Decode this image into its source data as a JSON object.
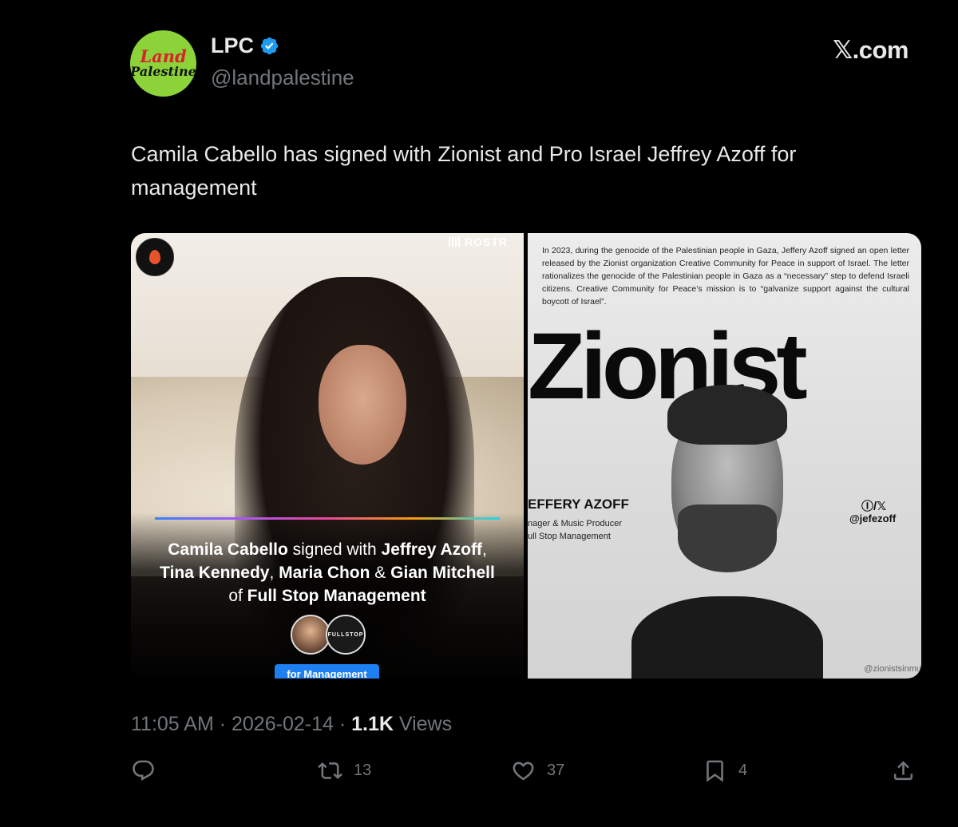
{
  "author": {
    "avatar_line1": "Land",
    "avatar_line2": "Palestine",
    "display_name": "LPC",
    "handle": "@landpalestine"
  },
  "brand": {
    "site_label": ".com",
    "x_glyph": "𝕏"
  },
  "tweet": {
    "text": "Camila Cabello has signed with  Zionist and Pro Israel Jeffrey Azoff for management"
  },
  "media": {
    "left": {
      "logo_brand": "ROSTR",
      "caption": {
        "name1": "Camila Cabello",
        "text1": " signed with ",
        "name2": "Jeffrey Azoff",
        "sep1": ",",
        "name3": "Tina Kennedy",
        "sep2": ", ",
        "name4": "Maria Chon",
        "sep3": " & ",
        "name5": "Gian Mitchell",
        "text2": "of ",
        "name6": "Full Stop Management"
      },
      "mini_logo_text": "FULLSTOP",
      "button_label": "for Management"
    },
    "right": {
      "letter": "In 2023, during the genocide of the Palestinian people in Gaza, Jeffery Azoff signed an open letter released by the Zionist organization Creative Community for Peace in support of Israel. The letter rationalizes the genocide of the Palestinian people in Gaza as a “necessary” step to defend Israeli citizens. Creative Community for Peace’s mission is to “galvanize support against the cultural boycott of Israel”.",
      "big_word": "Zionist",
      "person_name": "EFFERY AZOFF",
      "person_role1": "nager & Music Producer",
      "person_role2": "ull Stop Management",
      "social_icons": "Ⓘ/𝕏",
      "social_handle": "@jefezoff",
      "watermark": "@zionistsinmu"
    }
  },
  "meta": {
    "time": "11:05 AM",
    "sep1": " · ",
    "date": "2026-02-14",
    "sep2": " · ",
    "views_count": "1.1K",
    "views_label": " Views"
  },
  "actions": {
    "reply_count": "",
    "retweet_count": "13",
    "like_count": "37",
    "bookmark_count": "4"
  },
  "colors": {
    "background": "#000000",
    "text_primary": "#e7e9ea",
    "text_secondary": "#71767b",
    "verified_blue": "#1d9bf0",
    "avatar_green": "#8cd33a",
    "button_blue": "#1d7ff0"
  }
}
